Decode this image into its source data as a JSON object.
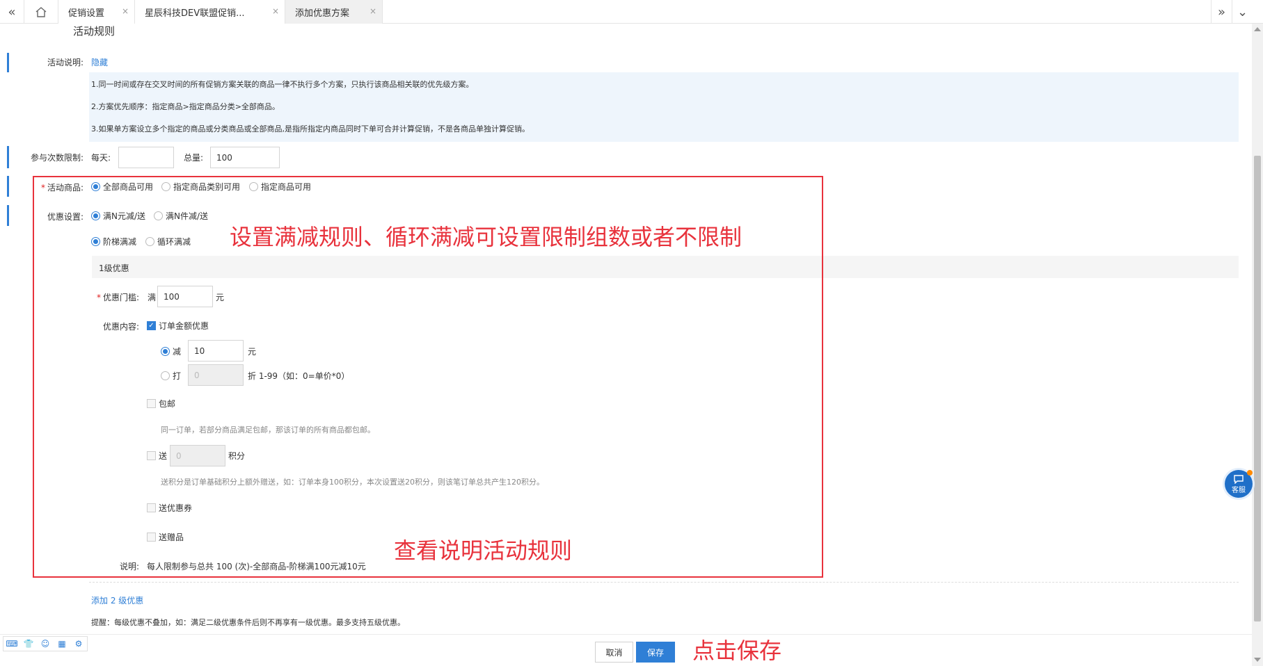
{
  "tabs": [
    {
      "label": "促销设置",
      "close": "×"
    },
    {
      "label": "星辰科技DEV联盟促销...",
      "close": "×"
    },
    {
      "label": "添加优惠方案",
      "close": "×"
    }
  ],
  "tabbar": {
    "prev_glyph": "«",
    "next_glyph": "»",
    "menu_glyph": "⌄"
  },
  "section_title": "活动规则",
  "description": {
    "label": "活动说明:",
    "toggle": "隐藏",
    "notes": [
      "1.同一时间或存在交叉时间的所有促销方案关联的商品一律不执行多个方案，只执行该商品相关联的优先级方案。",
      "2.方案优先顺序：指定商品>指定商品分类>全部商品。",
      "3.如果单方案设立多个指定的商品或分类商品或全部商品,是指所指定内商品同时下单可合并计算促销，不是各商品单独计算促销。"
    ]
  },
  "limit": {
    "label": "参与次数限制:",
    "daily_label": "每天:",
    "daily_value": "",
    "total_label": "总量:",
    "total_value": "100"
  },
  "goods": {
    "required": "*",
    "label": "活动商品:",
    "options": [
      "全部商品可用",
      "指定商品类别可用",
      "指定商品可用"
    ],
    "selected": 0
  },
  "discount": {
    "label": "优惠设置:",
    "type_options": [
      "满N元减/送",
      "满N件减/送"
    ],
    "type_selected": 0,
    "mode_options": [
      "阶梯满减",
      "循环满减"
    ],
    "mode_selected": 0
  },
  "level": {
    "title": "1级优惠",
    "threshold_required": "*",
    "threshold_label": "优惠门槛:",
    "threshold_prefix": "满",
    "threshold_value": "100",
    "threshold_unit": "元",
    "content_label": "优惠内容:",
    "order_discount_label": "订单金额优惠",
    "order_discount_checked": true,
    "reduce_label": "减",
    "reduce_value": "10",
    "reduce_unit": "元",
    "rate_label": "打",
    "rate_value": "0",
    "rate_hint": "折 1-99（如：0=单价*0）",
    "free_shipping_label": "包邮",
    "free_shipping_hint": "同一订单，若部分商品满足包邮，那该订单的所有商品都包邮。",
    "points_label": "送",
    "points_value": "0",
    "points_unit": "积分",
    "points_hint": "送积分是订单基础积分上额外赠送，如：订单本身100积分，本次设置送20积分，则该笔订单总共产生120积分。",
    "coupon_label": "送优惠券",
    "gift_label": "送赠品",
    "summary_label": "说明:",
    "summary_text": "每人限制参与总共 100 (次)-全部商品-阶梯满100元减10元"
  },
  "add_level_link": "添加 2 级优惠",
  "reminder": "提醒：每级优惠不叠加，如：满足二级优惠条件后则不再享有一级优惠。最多支持五级优惠。",
  "annotations": {
    "rule": "设置满减规则、循环满减可设置限制组数或者不限制",
    "read": "查看说明活动规则",
    "save": "点击保存"
  },
  "buttons": {
    "cancel": "取消",
    "save": "保存"
  },
  "kefu_label": "客服",
  "colors": {
    "accent": "#2f7fd6",
    "annotation": "#e8323c",
    "note_bg": "#eef5fc"
  }
}
